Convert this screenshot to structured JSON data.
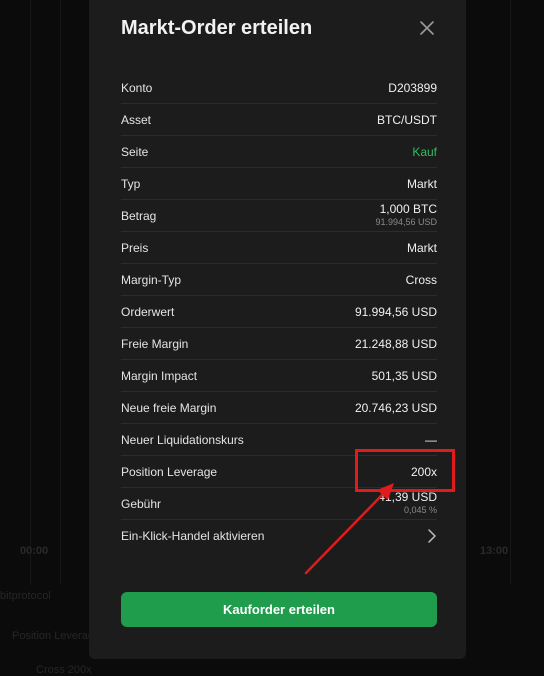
{
  "background": {
    "times": [
      "00:00",
      "13:00"
    ],
    "link_text": "bitprotocol",
    "bottom_left": "Position Leverage",
    "bottom_row": "Cross 200x"
  },
  "modal": {
    "title": "Markt-Order erteilen",
    "close_icon": "close-icon",
    "rows": [
      {
        "label": "Konto",
        "value": "D203899"
      },
      {
        "label": "Asset",
        "value": "BTC/USDT"
      },
      {
        "label": "Seite",
        "value": "Kauf",
        "color": "#2fbd62"
      },
      {
        "label": "Typ",
        "value": "Markt"
      },
      {
        "label": "Betrag",
        "value": "1,000 BTC",
        "sub": "91.994,56 USD"
      },
      {
        "label": "Preis",
        "value": "Markt"
      },
      {
        "label": "Margin-Typ",
        "value": "Cross"
      },
      {
        "label": "Orderwert",
        "value": "91.994,56 USD"
      },
      {
        "label": "Freie Margin",
        "value": "21.248,88 USD"
      },
      {
        "label": "Margin Impact",
        "value": "501,35 USD"
      },
      {
        "label": "Neue freie Margin",
        "value": "20.746,23 USD"
      },
      {
        "label": "Neuer Liquidationskurs",
        "value": "—"
      },
      {
        "label": "Position Leverage",
        "value": "200x"
      },
      {
        "label": "Gebühr",
        "value": "41,39 USD",
        "sub": "0,045 %"
      },
      {
        "label": "Ein-Klick-Handel aktivieren",
        "icon": "chevron-right-icon"
      }
    ],
    "submit_label": "Kauforder erteilen"
  },
  "colors": {
    "accent_green": "#1f9d4d",
    "annotation_red": "#e01b1b"
  }
}
